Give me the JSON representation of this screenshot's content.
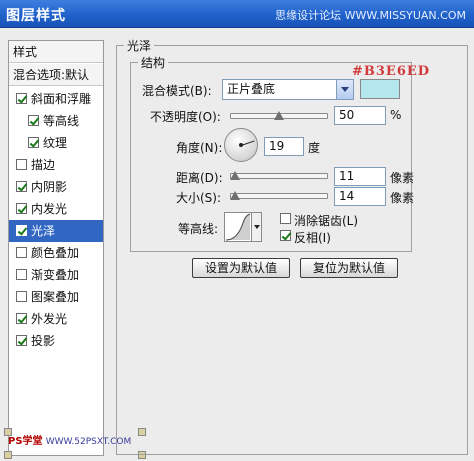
{
  "window": {
    "title": "图层样式",
    "watermark": "思缘设计论坛 WWW.MISSYUAN.COM"
  },
  "sidebar": {
    "header_styles": "样式",
    "header_blend": "混合选项:默认",
    "items": [
      {
        "label": "斜面和浮雕",
        "checked": true
      },
      {
        "label": "等高线",
        "checked": true
      },
      {
        "label": "纹理",
        "checked": true
      },
      {
        "label": "描边",
        "checked": false
      },
      {
        "label": "内阴影",
        "checked": true
      },
      {
        "label": "内发光",
        "checked": true
      },
      {
        "label": "光泽",
        "checked": true
      },
      {
        "label": "颜色叠加",
        "checked": false
      },
      {
        "label": "渐变叠加",
        "checked": false
      },
      {
        "label": "图案叠加",
        "checked": false
      },
      {
        "label": "外发光",
        "checked": true
      },
      {
        "label": "投影",
        "checked": true
      }
    ],
    "selected_index": 6
  },
  "footer_logo": {
    "ps": "PS学堂",
    "site": "WWW.52PSXT.COM"
  },
  "panel": {
    "group_title": "光泽",
    "section_title": "结构",
    "color_hex_note": "#B3E6ED",
    "blend_mode_label": "混合模式(B):",
    "blend_mode_value": "正片叠底",
    "color_swatch": "#b3e6ed",
    "opacity_label": "不透明度(O):",
    "opacity_value": "50",
    "opacity_unit": "%",
    "opacity_fraction": 0.5,
    "angle_label": "角度(N):",
    "angle_value": "19",
    "angle_unit": "度",
    "distance_label": "距离(D):",
    "distance_value": "11",
    "distance_unit": "像素",
    "size_label": "大小(S):",
    "size_value": "14",
    "size_unit": "像素",
    "contour_label": "等高线:",
    "anti_alias_label": "消除锯齿(L)",
    "anti_alias_checked": false,
    "invert_label": "反相(I)",
    "invert_checked": true,
    "make_default_label": "设置为默认值",
    "reset_default_label": "复位为默认值"
  },
  "colors": {
    "title_bar": "#1e5fc9",
    "selection": "#3167c3",
    "hex_note": "#d23a3a"
  }
}
